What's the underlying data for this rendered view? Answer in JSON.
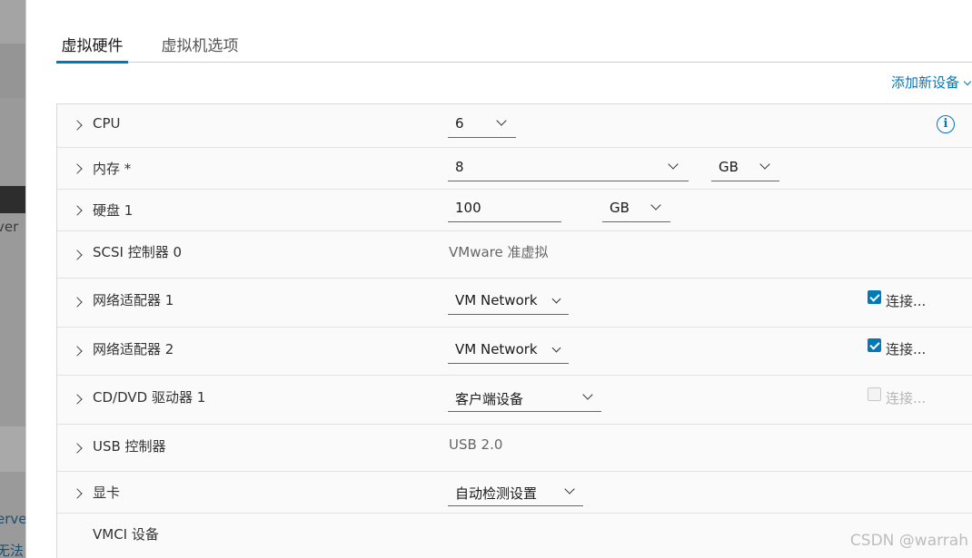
{
  "background_page": {
    "fragments": [
      "ver",
      "erve",
      "无法"
    ]
  },
  "dialog": {
    "tabs": [
      {
        "label": "虚拟硬件",
        "active": true
      },
      {
        "label": "虚拟机选项",
        "active": false
      }
    ],
    "add_device_label": "添加新设备",
    "devices": {
      "cpu": {
        "label": "CPU",
        "value": "6"
      },
      "memory": {
        "label": "内存 *",
        "value": "8",
        "unit": "GB"
      },
      "disk": {
        "label": "硬盘 1",
        "value": "100",
        "unit": "GB"
      },
      "scsi": {
        "label": "SCSI 控制器 0",
        "value": "VMware 准虚拟"
      },
      "net1": {
        "label": "网络适配器 1",
        "value": "VM Network",
        "connect_label": "连接...",
        "connected": true
      },
      "net2": {
        "label": "网络适配器 2",
        "value": "VM Network",
        "connect_label": "连接...",
        "connected": true
      },
      "cdrom": {
        "label": "CD/DVD 驱动器 1",
        "value": "客户端设备",
        "connect_label": "连接...",
        "connected": false
      },
      "usb": {
        "label": "USB 控制器",
        "value": "USB 2.0"
      },
      "video": {
        "label": "显卡",
        "value": "自动检测设置"
      },
      "vmci": {
        "label": "VMCI 设备"
      }
    }
  },
  "watermark": "CSDN @warrah",
  "colors": {
    "accent": "#0079b8",
    "table_bg": "#fafafa"
  }
}
